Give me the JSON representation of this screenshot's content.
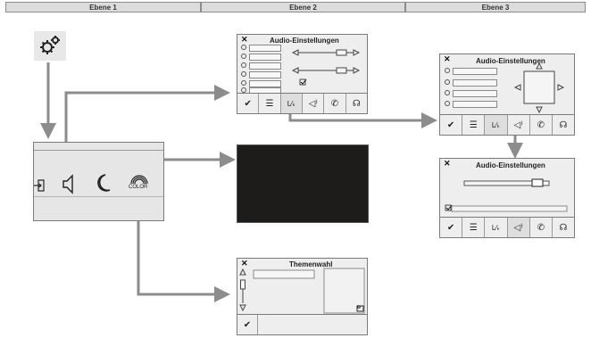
{
  "header": {
    "level1": "Ebene 1",
    "level2": "Ebene 2",
    "level3": "Ebene 3"
  },
  "home_panel": {
    "color_label": "COLOR"
  },
  "audio_panel": {
    "title": "Audio-Einstellungen"
  },
  "balance_panel": {
    "title": "Audio-Einstellungen"
  },
  "volume_panel": {
    "title": "Audio-Einstellungen"
  },
  "theme_panel": {
    "title": "Themenwahl"
  },
  "icons": {
    "settings": "gear-icon",
    "source": "source-input-icon",
    "speaker": "speaker-icon",
    "night": "moon-icon",
    "color": "rainbow-color-icon",
    "confirm": "checkmark-icon",
    "equalizer": "equalizer-icon",
    "loudness": "loudness-icon",
    "sound": "speaker-waves-icon",
    "phone": "phone-icon",
    "voice": "voice-icon",
    "close": "close-icon"
  },
  "colors": {
    "screen_black": "#1e1b1b",
    "arrow_gray": "#8c8c8c",
    "panel_gray": "#eeeeee"
  }
}
